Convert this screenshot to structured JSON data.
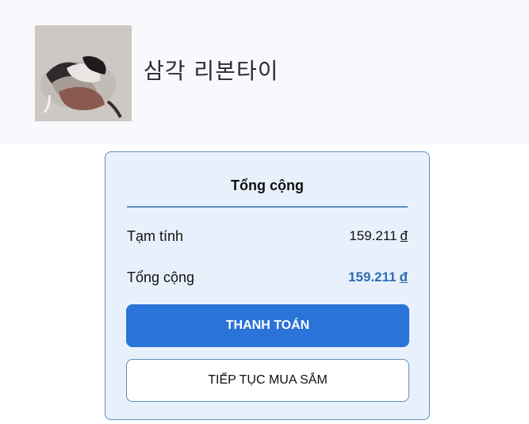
{
  "product": {
    "name": "삼각 리본타이",
    "image_icon": "product-thumbnail"
  },
  "summary": {
    "title": "Tổng cộng",
    "subtotal_label": "Tạm tính",
    "subtotal_value": "159.211",
    "total_label": "Tổng cộng",
    "total_value": "159.211",
    "currency": "đ",
    "checkout_label": "THANH TOÁN",
    "continue_label": "TIẾP TỤC MUA SẮM"
  },
  "colors": {
    "accent": "#2a73d8",
    "total_value": "#2f6db5",
    "card_bg": "#e8f1fb",
    "card_border": "#5d8ebe"
  }
}
